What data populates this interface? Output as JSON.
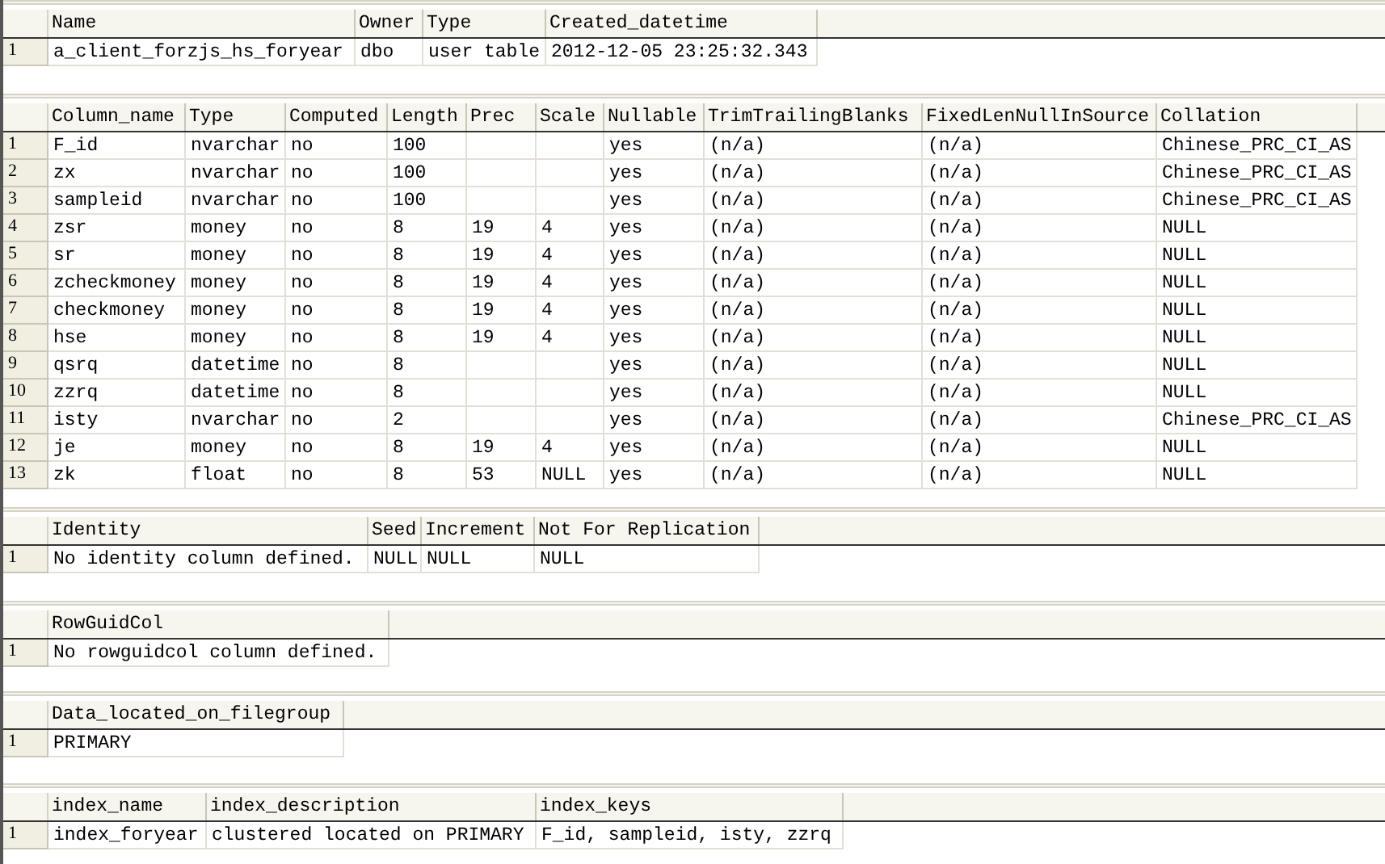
{
  "grids": [
    {
      "columns": [
        "Name",
        "Owner",
        "Type",
        "Created_datetime"
      ],
      "rows": [
        {
          "number": "1",
          "cells": [
            "a_client_forzjs_hs_foryear",
            "dbo",
            "user table",
            "2012-12-05 23:25:32.343"
          ]
        }
      ]
    },
    {
      "columns": [
        "Column_name",
        "Type",
        "Computed",
        "Length",
        "Prec",
        "Scale",
        "Nullable",
        "TrimTrailingBlanks",
        "FixedLenNullInSource",
        "Collation"
      ],
      "rows": [
        {
          "number": "1",
          "cells": [
            "F_id",
            "nvarchar",
            "no",
            "100",
            null,
            null,
            "yes",
            "(n/a)",
            "(n/a)",
            "Chinese_PRC_CI_AS"
          ]
        },
        {
          "number": "2",
          "cells": [
            "zx",
            "nvarchar",
            "no",
            "100",
            null,
            null,
            "yes",
            "(n/a)",
            "(n/a)",
            "Chinese_PRC_CI_AS"
          ]
        },
        {
          "number": "3",
          "cells": [
            "sampleid",
            "nvarchar",
            "no",
            "100",
            null,
            null,
            "yes",
            "(n/a)",
            "(n/a)",
            "Chinese_PRC_CI_AS"
          ]
        },
        {
          "number": "4",
          "cells": [
            "zsr",
            "money",
            "no",
            "8",
            "19",
            "4",
            "yes",
            "(n/a)",
            "(n/a)",
            "NULL"
          ]
        },
        {
          "number": "5",
          "cells": [
            "sr",
            "money",
            "no",
            "8",
            "19",
            "4",
            "yes",
            "(n/a)",
            "(n/a)",
            "NULL"
          ]
        },
        {
          "number": "6",
          "cells": [
            "zcheckmoney",
            "money",
            "no",
            "8",
            "19",
            "4",
            "yes",
            "(n/a)",
            "(n/a)",
            "NULL"
          ]
        },
        {
          "number": "7",
          "cells": [
            "checkmoney",
            "money",
            "no",
            "8",
            "19",
            "4",
            "yes",
            "(n/a)",
            "(n/a)",
            "NULL"
          ]
        },
        {
          "number": "8",
          "cells": [
            "hse",
            "money",
            "no",
            "8",
            "19",
            "4",
            "yes",
            "(n/a)",
            "(n/a)",
            "NULL"
          ]
        },
        {
          "number": "9",
          "cells": [
            "qsrq",
            "datetime",
            "no",
            "8",
            null,
            null,
            "yes",
            "(n/a)",
            "(n/a)",
            "NULL"
          ]
        },
        {
          "number": "10",
          "cells": [
            "zzrq",
            "datetime",
            "no",
            "8",
            null,
            null,
            "yes",
            "(n/a)",
            "(n/a)",
            "NULL"
          ]
        },
        {
          "number": "11",
          "cells": [
            "isty",
            "nvarchar",
            "no",
            "2",
            null,
            null,
            "yes",
            "(n/a)",
            "(n/a)",
            "Chinese_PRC_CI_AS"
          ]
        },
        {
          "number": "12",
          "cells": [
            "je",
            "money",
            "no",
            "8",
            "19",
            "4",
            "yes",
            "(n/a)",
            "(n/a)",
            "NULL"
          ]
        },
        {
          "number": "13",
          "cells": [
            "zk",
            "float",
            "no",
            "8",
            "53",
            "NULL",
            "yes",
            "(n/a)",
            "(n/a)",
            "NULL"
          ]
        }
      ]
    },
    {
      "columns": [
        "Identity",
        "Seed",
        "Increment",
        "Not For Replication"
      ],
      "rows": [
        {
          "number": "1",
          "cells": [
            "No identity column defined.",
            "NULL",
            "NULL",
            "NULL"
          ]
        }
      ]
    },
    {
      "columns": [
        "RowGuidCol"
      ],
      "rows": [
        {
          "number": "1",
          "cells": [
            "No rowguidcol column defined."
          ]
        }
      ]
    },
    {
      "columns": [
        "Data_located_on_filegroup"
      ],
      "rows": [
        {
          "number": "1",
          "cells": [
            "PRIMARY"
          ]
        }
      ]
    },
    {
      "columns": [
        "index_name",
        "index_description",
        "index_keys"
      ],
      "rows": [
        {
          "number": "1",
          "cells": [
            "index_foryear",
            "clustered located on PRIMARY",
            "F_id, sampleid, isty, zzrq"
          ]
        }
      ]
    }
  ]
}
